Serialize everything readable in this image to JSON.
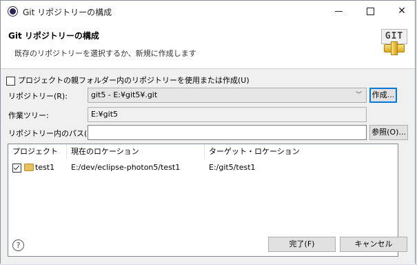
{
  "window": {
    "title": "Git リポジトリーの構成"
  },
  "header": {
    "title": "Git リポジトリーの構成",
    "description": "既存のリポジトリーを選択するか、新規に作成します",
    "logo_text": "GIT"
  },
  "form": {
    "checkbox_label": "プロジェクトの親フォルダー内のリポジトリーを使用または作成(U)",
    "checkbox_checked": false,
    "repository_label": "リポジトリー(R):",
    "repository_value": "git5 - E:¥git5¥.git",
    "create_button": "作成...",
    "worktree_label": "作業ツリー:",
    "worktree_value": "E:¥git5",
    "path_label": "リポジトリー内のパス(P):",
    "path_value": "",
    "browse_button": "参照(O)..."
  },
  "table": {
    "columns": [
      "プロジェクト",
      "現在のロケーション",
      "ターゲット・ロケーション"
    ],
    "rows": [
      {
        "checked": true,
        "project": "test1",
        "current": "E:/dev/eclipse-photon5/test1",
        "target": "E:/git5/test1"
      }
    ]
  },
  "footer": {
    "help_icon": "?",
    "finish_button": "完了(F)",
    "cancel_button": "キャンセル"
  }
}
